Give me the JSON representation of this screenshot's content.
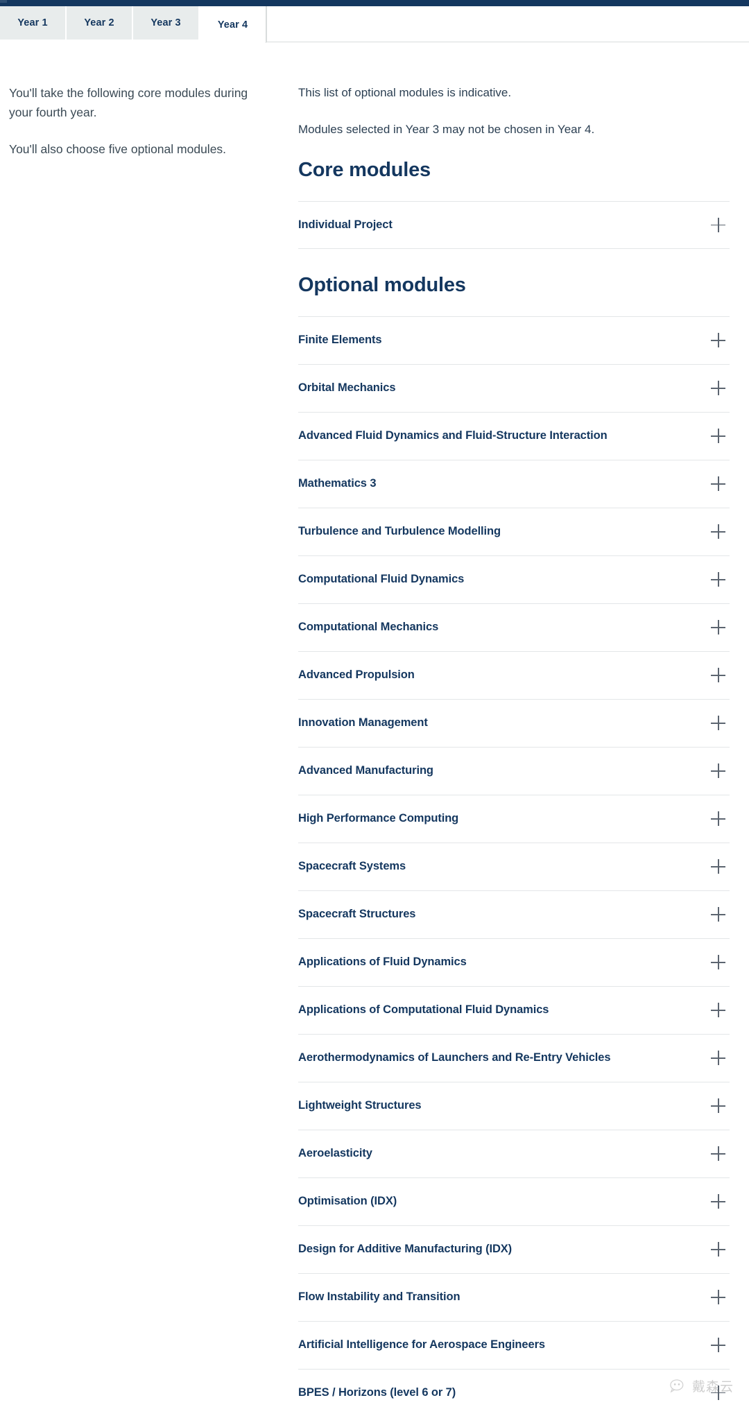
{
  "theme": {
    "navy": "#14375f",
    "tab_inactive_bg": "#e8ecec",
    "divider": "#e3e6e8",
    "body_text": "#3b4a55"
  },
  "tabs": [
    {
      "label": "Year 1",
      "active": false
    },
    {
      "label": "Year 2",
      "active": false
    },
    {
      "label": "Year 3",
      "active": false
    },
    {
      "label": "Year 4",
      "active": true
    }
  ],
  "left_column": {
    "paragraph_1": "You'll take the following core modules during your fourth year.",
    "paragraph_2": "You'll also choose five optional modules."
  },
  "right_column": {
    "intro_1": "This list of optional modules is indicative.",
    "intro_2": "Modules selected in Year 3 may not be chosen in Year 4.",
    "core_heading": "Core modules",
    "optional_heading": "Optional modules",
    "expand_icon": "plus-icon"
  },
  "core_modules": [
    {
      "label": "Individual Project"
    }
  ],
  "optional_modules": [
    {
      "label": "Finite Elements"
    },
    {
      "label": "Orbital Mechanics"
    },
    {
      "label": "Advanced Fluid Dynamics and Fluid-Structure Interaction"
    },
    {
      "label": "Mathematics 3"
    },
    {
      "label": "Turbulence and Turbulence Modelling"
    },
    {
      "label": "Computational Fluid Dynamics"
    },
    {
      "label": "Computational Mechanics"
    },
    {
      "label": "Advanced Propulsion"
    },
    {
      "label": "Innovation Management"
    },
    {
      "label": "Advanced Manufacturing"
    },
    {
      "label": "High Performance Computing"
    },
    {
      "label": "Spacecraft Systems"
    },
    {
      "label": "Spacecraft Structures"
    },
    {
      "label": "Applications of Fluid Dynamics"
    },
    {
      "label": "Applications of Computational Fluid Dynamics"
    },
    {
      "label": "Aerothermodynamics of Launchers and Re-Entry Vehicles"
    },
    {
      "label": "Lightweight Structures"
    },
    {
      "label": "Aeroelasticity"
    },
    {
      "label": "Optimisation (IDX)"
    },
    {
      "label": "Design for Additive Manufacturing (IDX)"
    },
    {
      "label": "Flow Instability and Transition"
    },
    {
      "label": "Artificial Intelligence for Aerospace Engineers"
    },
    {
      "label": "BPES / Horizons (level 6 or 7)"
    }
  ],
  "watermark": {
    "text": "戴森云",
    "icon": "wechat-icon"
  }
}
